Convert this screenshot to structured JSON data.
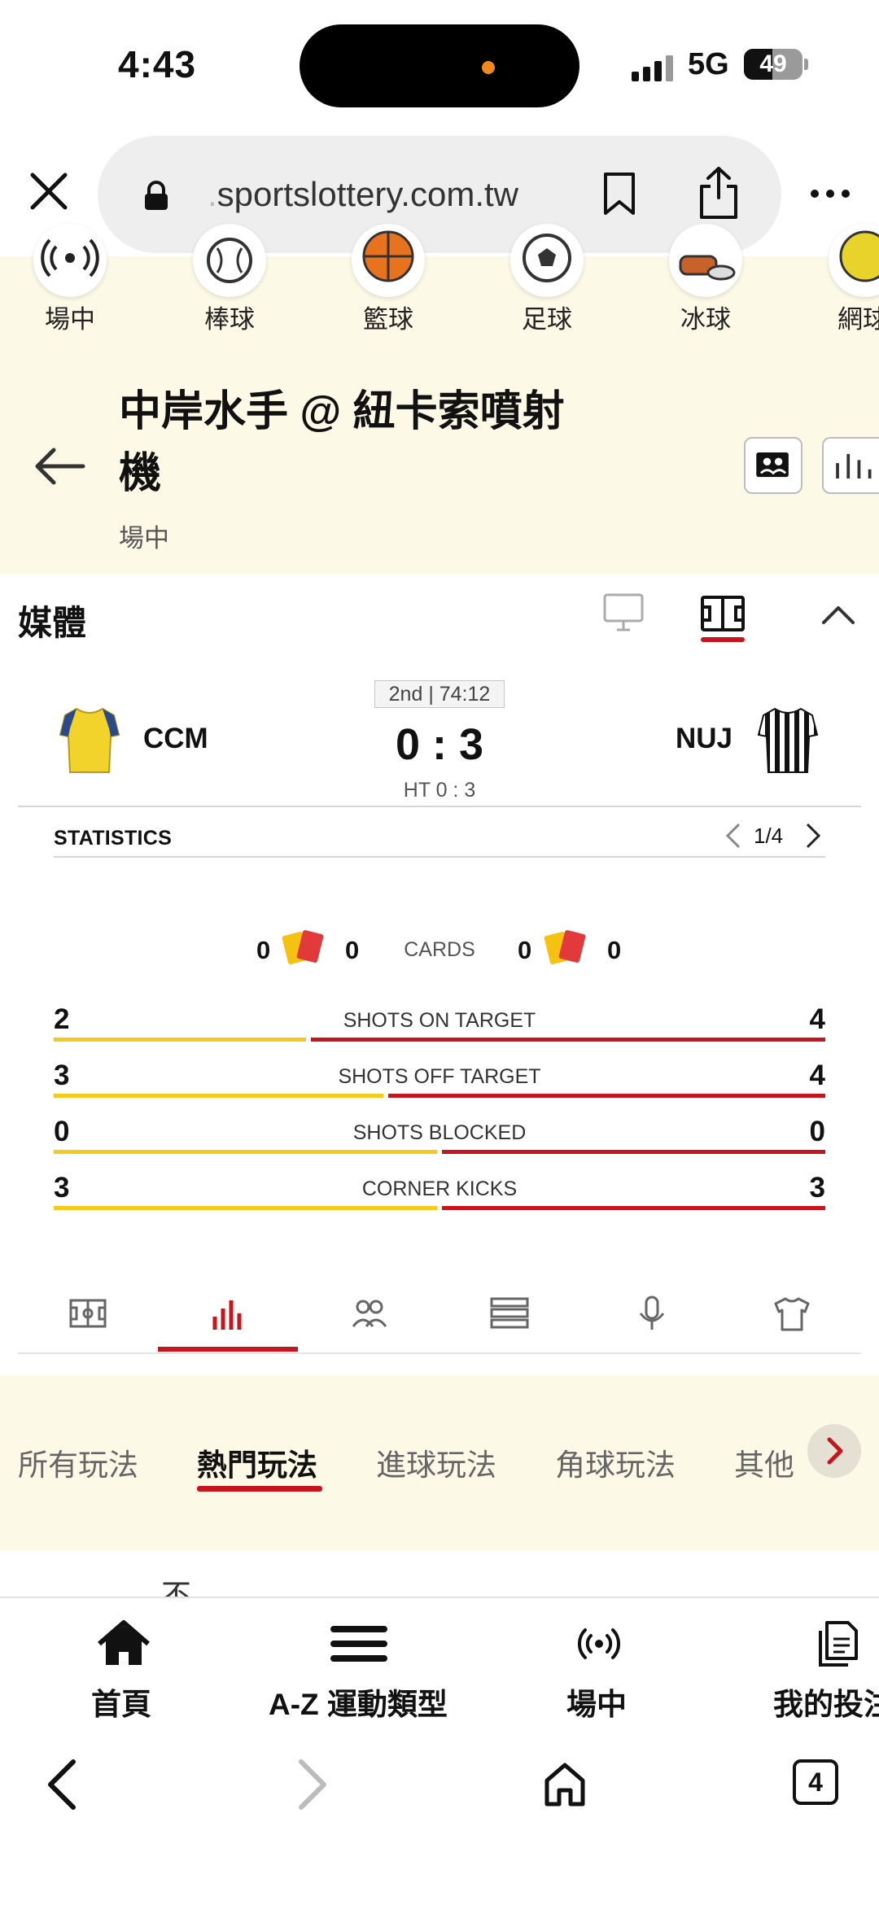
{
  "status_bar": {
    "time": "4:43",
    "network": "5G",
    "battery": "49",
    "battery_level": 0.49
  },
  "browser": {
    "url_prefix": ".",
    "url_domain": "sportslottery.com.tw"
  },
  "sports_nav": {
    "items": [
      {
        "label": "場中",
        "icon": "live-broadcast-icon"
      },
      {
        "label": "棒球",
        "icon": "baseball-icon"
      },
      {
        "label": "籃球",
        "icon": "basketball-icon"
      },
      {
        "label": "足球",
        "icon": "soccer-ball-icon"
      },
      {
        "label": "冰球",
        "icon": "ice-hockey-icon"
      },
      {
        "label": "網球",
        "icon": "tennis-ball-icon"
      }
    ]
  },
  "match": {
    "title": "中岸水手 @ 紐卡索噴射機",
    "subtitle": "場中"
  },
  "media": {
    "title": "媒體"
  },
  "scoreboard": {
    "period": "2nd | 74:12",
    "home_team": "CCM",
    "away_team": "NUJ",
    "score": "0 : 3",
    "halftime": "HT 0 : 3",
    "home_color": "#f6ca1d",
    "away_color": "#c4161c"
  },
  "statistics": {
    "label": "STATISTICS",
    "page": "1/4",
    "cards": {
      "label": "CARDS",
      "home_yellow": "0",
      "home_red": "0",
      "away_yellow": "0",
      "away_red": "0"
    },
    "rows": [
      {
        "label": "SHOTS ON TARGET",
        "home": "2",
        "away": "4",
        "home_share": 0.33
      },
      {
        "label": "SHOTS OFF TARGET",
        "home": "3",
        "away": "4",
        "home_share": 0.43
      },
      {
        "label": "SHOTS BLOCKED",
        "home": "0",
        "away": "0",
        "home_share": 0.5
      },
      {
        "label": "CORNER KICKS",
        "home": "3",
        "away": "3",
        "home_share": 0.5
      }
    ]
  },
  "bet_tabs": {
    "items": [
      "所有玩法",
      "熱門玩法",
      "進球玩法",
      "角球玩法",
      "其他"
    ],
    "active": "熱門玩法"
  },
  "partial_text": "不",
  "app_nav": {
    "items": [
      {
        "label": "首頁",
        "icon": "home-icon"
      },
      {
        "label": "A-Z 運動類型",
        "icon": "menu-icon"
      },
      {
        "label": "場中",
        "icon": "live-broadcast-icon"
      },
      {
        "label": "我的投注",
        "icon": "documents-icon"
      }
    ]
  },
  "browser_toolbar": {
    "tab_count": "4"
  }
}
